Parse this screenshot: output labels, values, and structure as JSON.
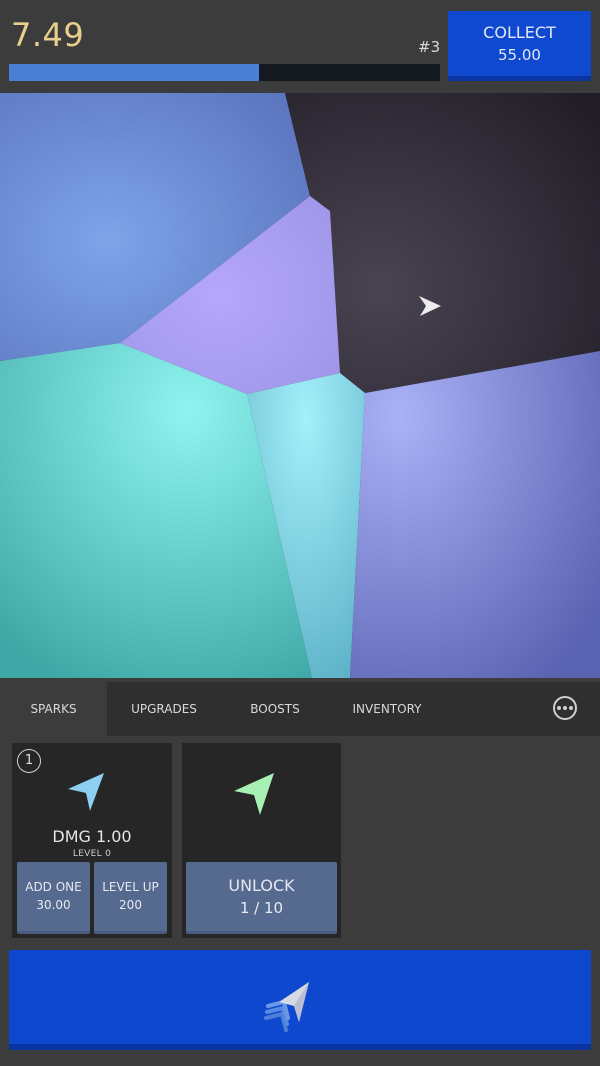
{
  "hud": {
    "score": "7.49",
    "stage": "#3",
    "progress_fraction": 0.58,
    "collect_label": "COLLECT",
    "collect_value": "55.00"
  },
  "colors": {
    "accent_blue": "#0e49d0",
    "progress_fill": "#4a7fd6",
    "score_gold": "#e8cf8d",
    "card_button": "#56698f"
  },
  "tabs": [
    {
      "label": "SPARKS",
      "active": true
    },
    {
      "label": "UPGRADES",
      "active": false
    },
    {
      "label": "BOOSTS",
      "active": false
    },
    {
      "label": "INVENTORY",
      "active": false
    }
  ],
  "more_icon": "ellipsis-circle-icon",
  "cards": [
    {
      "badge": "1",
      "icon": "blue-spark-arrow-icon",
      "damage": "DMG 1.00",
      "level": "LEVEL 0",
      "add_label": "ADD ONE",
      "add_cost": "30.00",
      "levelup_label": "LEVEL UP",
      "levelup_cost": "200"
    },
    {
      "icon": "green-spark-arrow-icon",
      "unlock_label": "UNLOCK",
      "unlock_progress": "1 / 10"
    }
  ],
  "launch_icon": "spark-launch-icon"
}
